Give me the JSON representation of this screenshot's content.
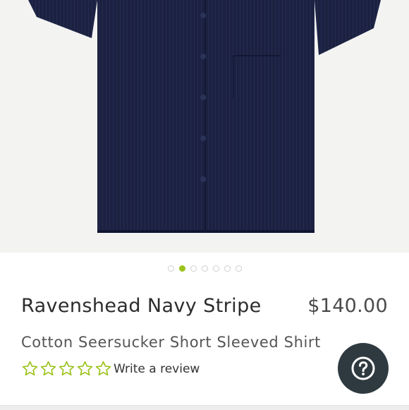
{
  "product": {
    "name": "Ravenshead Navy Stripe",
    "price": "$140.00",
    "description": "Cotton Seersucker Short Sleeved Shirt"
  },
  "gallery": {
    "image_label": "navy seersucker shirt product photo",
    "slide_count": 7,
    "active_index": 1
  },
  "rating": {
    "stars_filled": 0,
    "stars_total": 5,
    "review_link": "Write a review"
  },
  "help": {
    "icon": "question-mark-icon"
  },
  "colors": {
    "accent_green": "#9bc21b",
    "shirt_navy": "#1b2140",
    "help_button": "#2f3a40"
  }
}
